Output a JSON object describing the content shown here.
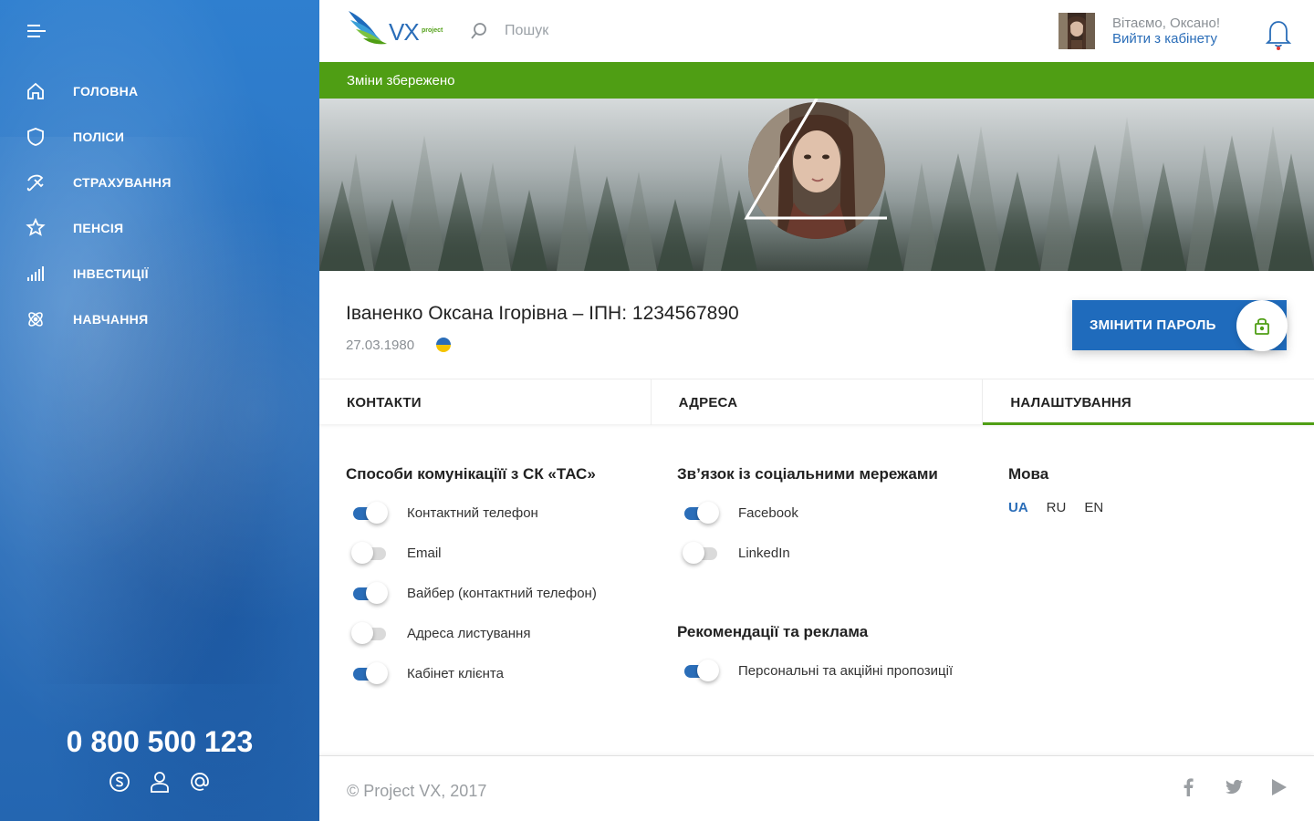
{
  "sidebar": {
    "items": [
      {
        "label": "ГОЛОВНА",
        "icon": "home-icon"
      },
      {
        "label": "ПОЛІСИ",
        "icon": "shield-icon"
      },
      {
        "label": "СТРАХУВАННЯ",
        "icon": "umbrella-icon"
      },
      {
        "label": "ПЕНСІЯ",
        "icon": "star-icon"
      },
      {
        "label": "ІНВЕСТИЦІЇ",
        "icon": "bar-chart-icon"
      },
      {
        "label": "НАВЧАННЯ",
        "icon": "atom-icon"
      }
    ],
    "phone": "0 800 500 123",
    "contact_icons": [
      "skype-icon",
      "user-icon",
      "at-icon"
    ]
  },
  "header": {
    "logo_text": "VX",
    "logo_sub": "project",
    "search_placeholder": "Пошук",
    "greeting": "Вітаємо, Оксано!",
    "logout": "Вийти з кабінету"
  },
  "notice": {
    "text": "Зміни збережено"
  },
  "profile": {
    "name": "Іваненко Оксана Ігорівна – ІПН: 1234567890",
    "dob": "27.03.1980",
    "change_password": "ЗМІНИТИ ПАРОЛЬ"
  },
  "tabs": [
    {
      "label": "КОНТАКТИ"
    },
    {
      "label": "АДРЕСА"
    },
    {
      "label": "НАЛАШТУВАННЯ",
      "active": true
    }
  ],
  "settings": {
    "communication": {
      "title": "Способи комунікаціїї з СК «ТАС»",
      "items": [
        {
          "label": "Контактний телефон",
          "on": true
        },
        {
          "label": "Email",
          "on": false
        },
        {
          "label": "Вайбер (контактний телефон)",
          "on": true
        },
        {
          "label": "Адреса листування",
          "on": false
        },
        {
          "label": "Кабінет клієнта",
          "on": true
        }
      ]
    },
    "social": {
      "title": "Зв’язок із соціальними мережами",
      "items": [
        {
          "label": "Facebook",
          "on": true
        },
        {
          "label": "LinkedIn",
          "on": false
        }
      ]
    },
    "ads": {
      "title": "Рекомендації та реклама",
      "items": [
        {
          "label": "Персональні та акційні пропозиції",
          "on": true
        }
      ]
    },
    "language": {
      "title": "Мова",
      "options": [
        "UA",
        "RU",
        "EN"
      ],
      "selected": "UA"
    }
  },
  "footer": {
    "copyright": "© Project VX, 2017",
    "socials": [
      "facebook-icon",
      "twitter-icon",
      "youtube-play-icon"
    ]
  },
  "colors": {
    "brand_blue": "#2a6db8",
    "accent_green": "#4f9e14"
  }
}
